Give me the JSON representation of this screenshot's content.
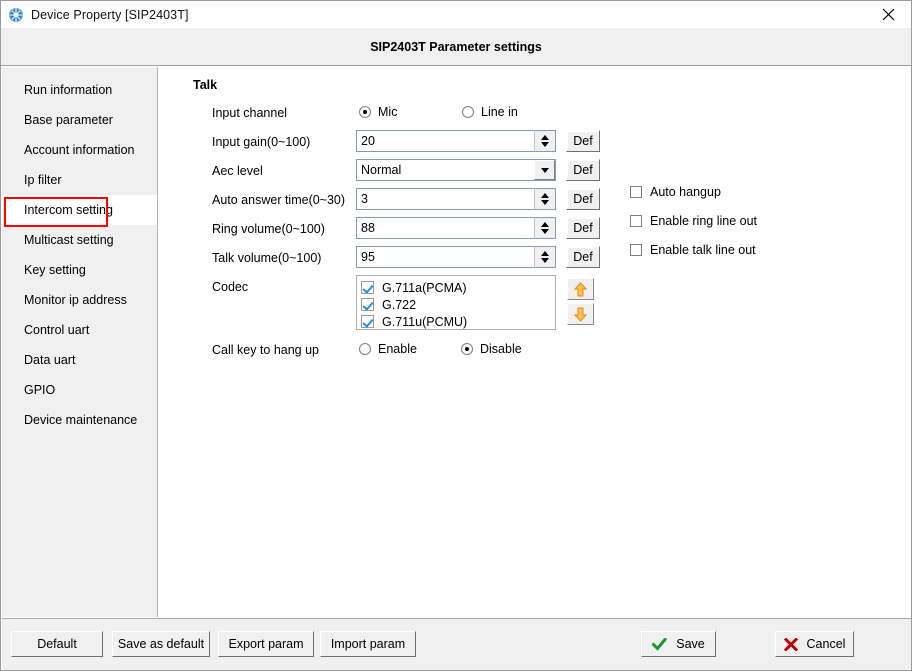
{
  "window": {
    "title": "Device Property [SIP2403T]",
    "icon": "globe-network-icon",
    "close_label": "✕"
  },
  "header": {
    "title": "SIP2403T Parameter settings"
  },
  "sidebar": {
    "items": [
      {
        "label": "Run information"
      },
      {
        "label": "Base parameter"
      },
      {
        "label": "Account information"
      },
      {
        "label": "Ip filter"
      },
      {
        "label": "Intercom setting"
      },
      {
        "label": "Multicast setting"
      },
      {
        "label": "Key setting"
      },
      {
        "label": "Monitor ip address"
      },
      {
        "label": "Control uart"
      },
      {
        "label": "Data uart"
      },
      {
        "label": "GPIO"
      },
      {
        "label": "Device maintenance"
      }
    ],
    "selected_index": 4,
    "highlight_color": "#ff0000"
  },
  "main": {
    "section_title": "Talk",
    "fields": {
      "input_channel": {
        "label": "Input channel",
        "options": [
          {
            "label": "Mic",
            "selected": true
          },
          {
            "label": "Line in",
            "selected": false
          }
        ]
      },
      "input_gain": {
        "label": "Input gain(0~100)",
        "value": "20",
        "def_label": "Def"
      },
      "aec_level": {
        "label": "Aec level",
        "value": "Normal",
        "def_label": "Def"
      },
      "auto_answer_time": {
        "label": "Auto answer time(0~30)",
        "value": "3",
        "def_label": "Def"
      },
      "ring_volume": {
        "label": "Ring volume(0~100)",
        "value": "88",
        "def_label": "Def"
      },
      "talk_volume": {
        "label": "Talk volume(0~100)",
        "value": "95",
        "def_label": "Def"
      },
      "codec": {
        "label": "Codec",
        "items": [
          {
            "label": "G.711a(PCMA)",
            "checked": true
          },
          {
            "label": "G.722",
            "checked": true
          },
          {
            "label": "G.711u(PCMU)",
            "checked": true
          }
        ],
        "move_up": "move-up-arrow",
        "move_down": "move-down-arrow",
        "arrow_color": "#f5a623"
      },
      "call_key_hangup": {
        "label": "Call key to hang up",
        "options": [
          {
            "label": "Enable",
            "selected": false
          },
          {
            "label": "Disable",
            "selected": true
          }
        ]
      }
    },
    "toggles": [
      {
        "label": "Auto hangup",
        "checked": false
      },
      {
        "label": "Enable ring line out",
        "checked": false
      },
      {
        "label": "Enable talk line out",
        "checked": false
      }
    ]
  },
  "footer": {
    "default_label": "Default",
    "save_as_default_label": "Save as default",
    "export_label": "Export param",
    "import_label": "Import param",
    "save_label": "Save",
    "cancel_label": "Cancel",
    "save_icon_color": "#1a9a24",
    "cancel_icon_color": "#c00000"
  }
}
